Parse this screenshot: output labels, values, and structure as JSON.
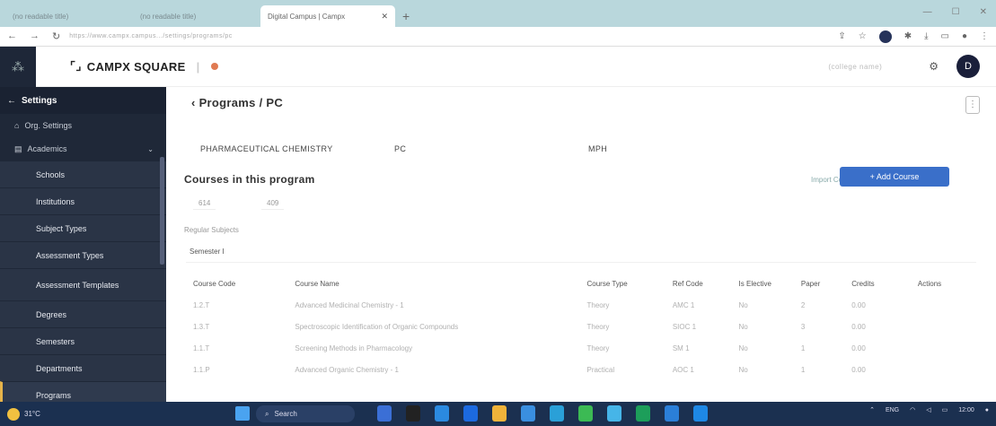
{
  "browser": {
    "tabs": [
      {
        "label": "(no readable title)"
      },
      {
        "label": "(no readable title)"
      },
      {
        "label": "Digital Campus | Campx"
      }
    ],
    "new_tab": "+",
    "url": "https://www.campx.campus.../settings/programs/pc"
  },
  "header": {
    "brand": "CAMPX SQUARE",
    "college": "(college name)",
    "avatar_letter": "D"
  },
  "sidebar": {
    "back_label": "Settings",
    "items": [
      {
        "label": "Org. Settings"
      },
      {
        "label": "Academics"
      }
    ],
    "sub_items": [
      {
        "label": "Schools"
      },
      {
        "label": "Institutions"
      },
      {
        "label": "Subject Types"
      },
      {
        "label": "Assessment Types"
      },
      {
        "label": "Assessment Templates"
      },
      {
        "label": "Degrees"
      },
      {
        "label": "Semesters"
      },
      {
        "label": "Departments"
      },
      {
        "label": "Programs"
      }
    ]
  },
  "main": {
    "breadcrumb": "Programs / PC",
    "program_name": "PHARMACEUTICAL CHEMISTRY",
    "program_code": "PC",
    "degree": "MPH",
    "section_title": "Courses in this program",
    "import_label": "Import Courses",
    "add_course_label": "+ Add Course",
    "filters": [
      "614",
      "409"
    ],
    "regular_subjects": "Regular Subjects",
    "semester_label": "Semester I",
    "table": {
      "headers": [
        "Course Code",
        "Course Name",
        "Course Type",
        "Ref Code",
        "Is Elective",
        "Paper",
        "Credits",
        "Actions"
      ],
      "rows": [
        [
          "1.2.T",
          "Advanced Medicinal Chemistry - 1",
          "Theory",
          "AMC 1",
          "No",
          "2",
          "0.00",
          ""
        ],
        [
          "1.3.T",
          "Spectroscopic Identification of Organic Compounds",
          "Theory",
          "SIOC 1",
          "No",
          "3",
          "0.00",
          ""
        ],
        [
          "1.1.T",
          "Screening Methods in Pharmacology",
          "Theory",
          "SM 1",
          "No",
          "1",
          "0.00",
          ""
        ],
        [
          "1.1.P",
          "Advanced Organic Chemistry - 1",
          "Practical",
          "AOC 1",
          "No",
          "1",
          "0.00",
          ""
        ]
      ]
    }
  },
  "taskbar": {
    "weather": "31°C",
    "search": "Search",
    "lang": "ENG",
    "time": "12:00"
  }
}
